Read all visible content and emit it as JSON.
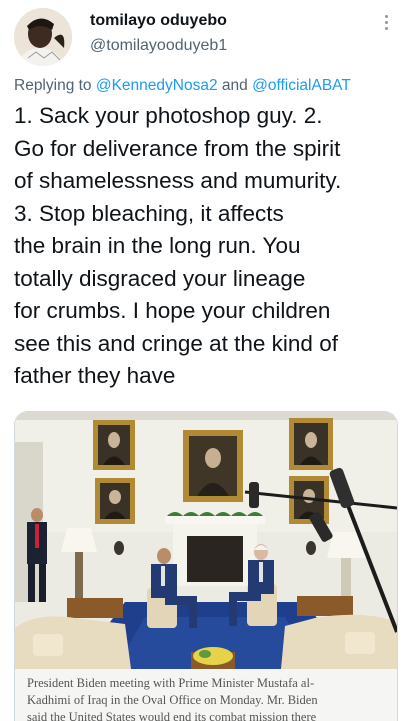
{
  "tweet": {
    "display_name": "tomilayo oduyebo",
    "handle": "@tomilayooduyeb1",
    "reply_prefix": "Replying to",
    "reply_mention_1": "@KennedyNosa2",
    "reply_joiner": "and",
    "reply_mention_2": "@officialABAT",
    "text_lines": [
      "1. Sack your photoshop guy. 2.",
      "Go for deliverance from the spirit",
      "of shamelessness and mumurity.",
      "3. Stop bleaching, it affects",
      "the brain in the long run. You",
      "totally disgraced your lineage",
      "for crumbs. I hope your children",
      "see this and cringe at the kind of",
      "father they have"
    ],
    "more_icon": "vertical-ellipsis-icon",
    "avatar_icon": "user-avatar"
  },
  "media": {
    "caption_lines": [
      "President Biden meeting with Prime Minister Mustafa al-",
      "Kadhimi of Iraq in the Oval Office on Monday. Mr. Biden",
      "said the United States would end its combat mission there"
    ]
  },
  "colors": {
    "mention": "#1d9bf0",
    "secondary_text": "#536471",
    "primary_text": "#0f1419",
    "carpet": "#1f3f8c"
  }
}
